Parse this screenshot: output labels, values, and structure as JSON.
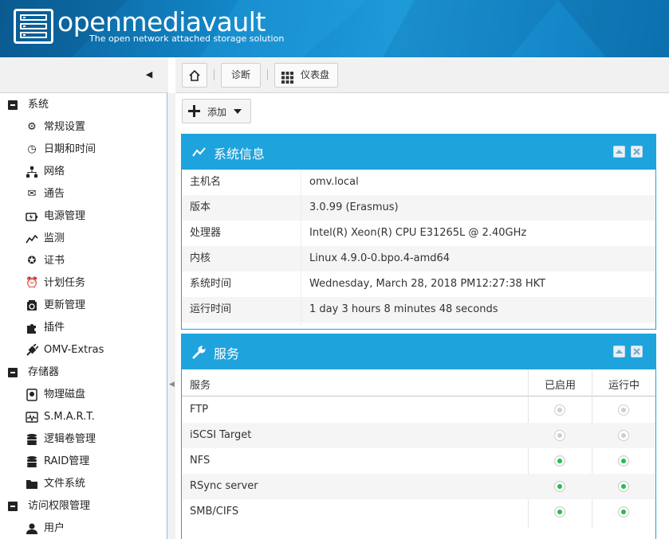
{
  "header": {
    "brand": "openmediavault",
    "tagline": "The open network attached storage solution"
  },
  "toolbar": {
    "home_icon": "home-icon",
    "diagnostics_label": "诊断",
    "dashboard_label": "仪表盘",
    "add_label": "添加"
  },
  "nav": {
    "groups": [
      {
        "label": "系统",
        "items": [
          {
            "label": "常规设置",
            "icon": "gears-icon"
          },
          {
            "label": "日期和时间",
            "icon": "clock-icon"
          },
          {
            "label": "网络",
            "icon": "network-icon"
          },
          {
            "label": "通告",
            "icon": "envelope-icon"
          },
          {
            "label": "电源管理",
            "icon": "power-icon"
          },
          {
            "label": "监测",
            "icon": "chart-line-icon"
          },
          {
            "label": "证书",
            "icon": "certificate-icon"
          },
          {
            "label": "计划任务",
            "icon": "alarm-clock-icon"
          },
          {
            "label": "更新管理",
            "icon": "update-icon"
          },
          {
            "label": "插件",
            "icon": "puzzle-icon"
          },
          {
            "label": "OMV-Extras",
            "icon": "plug-icon"
          }
        ]
      },
      {
        "label": "存储器",
        "items": [
          {
            "label": "物理磁盘",
            "icon": "disk-icon"
          },
          {
            "label": "S.M.A.R.T.",
            "icon": "heartbeat-icon"
          },
          {
            "label": "逻辑卷管理",
            "icon": "database-icon"
          },
          {
            "label": "RAID管理",
            "icon": "database-icon"
          },
          {
            "label": "文件系统",
            "icon": "folder-icon"
          }
        ]
      },
      {
        "label": "访问权限管理",
        "items": [
          {
            "label": "用户",
            "icon": "user-icon"
          }
        ]
      }
    ]
  },
  "sysinfo": {
    "title": "系统信息",
    "rows": [
      {
        "key": "主机名",
        "value": "omv.local"
      },
      {
        "key": "版本",
        "value": "3.0.99 (Erasmus)"
      },
      {
        "key": "处理器",
        "value": "Intel(R) Xeon(R) CPU E31265L @ 2.40GHz"
      },
      {
        "key": "内核",
        "value": "Linux 4.9.0-0.bpo.4-amd64"
      },
      {
        "key": "系统时间",
        "value": "Wednesday, March 28, 2018 PM12:27:38 HKT"
      },
      {
        "key": "运行时间",
        "value": "1 day 3 hours 8 minutes 48 seconds"
      }
    ]
  },
  "services": {
    "title": "服务",
    "columns": [
      "服务",
      "已启用",
      "运行中"
    ],
    "rows": [
      {
        "name": "FTP",
        "enabled": false,
        "running": false
      },
      {
        "name": "iSCSI Target",
        "enabled": false,
        "running": false
      },
      {
        "name": "NFS",
        "enabled": true,
        "running": true
      },
      {
        "name": "RSync server",
        "enabled": true,
        "running": true
      },
      {
        "name": "SMB/CIFS",
        "enabled": true,
        "running": true
      }
    ]
  },
  "colors": {
    "header_blue": "#1387c8",
    "widget_blue": "#1fa3dc",
    "status_green": "#1ec04a",
    "status_grey": "#cfcfcf"
  }
}
